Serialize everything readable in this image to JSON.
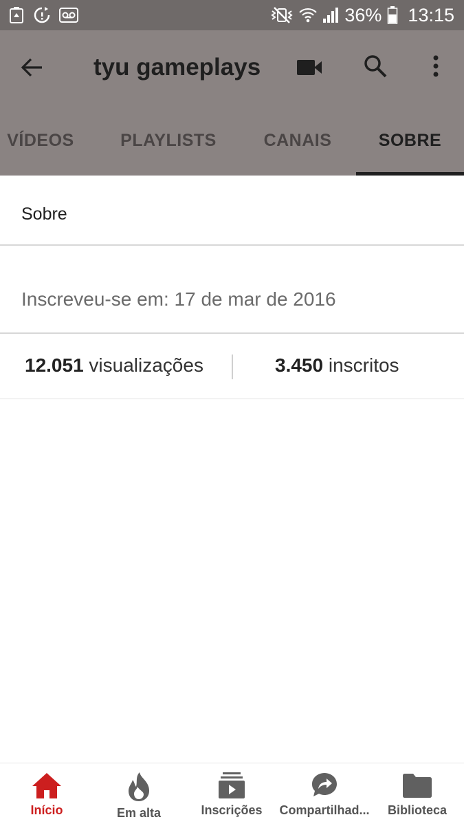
{
  "status_bar": {
    "left_icons": [
      "recycle-icon",
      "sync-alert-icon",
      "voicemail-icon"
    ],
    "right_icons": [
      "mute-vibrate-icon",
      "wifi-icon",
      "signal-icon",
      "battery-icon"
    ],
    "battery": "36%",
    "time": "13:15"
  },
  "toolbar": {
    "title": "tyu gameplays"
  },
  "tabs": [
    {
      "label": "VÍDEOS"
    },
    {
      "label": "PLAYLISTS"
    },
    {
      "label": "CANAIS"
    },
    {
      "label": "SOBRE",
      "active": true
    }
  ],
  "about": {
    "section_title": "Sobre",
    "joined": "Inscreveu-se em: 17 de mar de 2016",
    "views_count": "12.051",
    "views_label": "visualizações",
    "subscribers_count": "3.450",
    "subscribers_label": "inscritos"
  },
  "bottom_nav": [
    {
      "label": "Início",
      "icon": "home-icon",
      "active": true
    },
    {
      "label": "Em alta",
      "icon": "flame-icon"
    },
    {
      "label": "Inscrições",
      "icon": "subscriptions-icon"
    },
    {
      "label": "Compartilhad...",
      "icon": "share-bubble-icon"
    },
    {
      "label": "Biblioteca",
      "icon": "folder-icon"
    }
  ],
  "colors": {
    "status_bar": "#6f6a69",
    "app_bar": "#8a8382",
    "active_nav": "#cc1f1f"
  }
}
